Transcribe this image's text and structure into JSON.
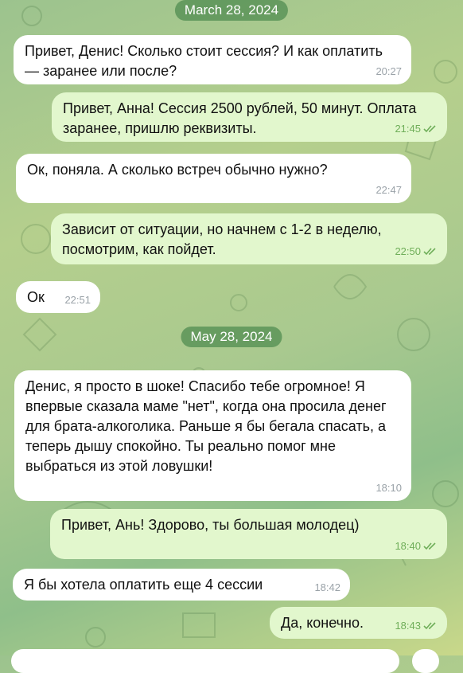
{
  "colors": {
    "incoming_bg": "#ffffff",
    "outgoing_bg": "#e2f7cd",
    "date_pill_bg": "#5a9a5a",
    "outgoing_time": "#6fae59"
  },
  "dates": {
    "first": "March 28, 2024",
    "second": "May 28, 2024"
  },
  "messages": [
    {
      "direction": "in",
      "text": "Привет, Денис! Сколько стоит сессия? И как оплатить — заранее или после?",
      "time": "20:27",
      "read": false
    },
    {
      "direction": "out",
      "text": "Привет, Анна! Сессия 2500 рублей, 50 минут. Оплата заранее, пришлю реквизиты.",
      "time": "21:45",
      "read": true
    },
    {
      "direction": "in",
      "text": "Ок, поняла. А сколько встреч обычно нужно?",
      "time": "22:47",
      "read": false
    },
    {
      "direction": "out",
      "text": "Зависит от ситуации, но начнем с 1-2 в неделю, посмотрим, как пойдет.",
      "time": "22:50",
      "read": true
    },
    {
      "direction": "in",
      "text": "Ок",
      "time": "22:51",
      "read": false
    },
    {
      "direction": "in",
      "text": "Денис, я просто в шоке! Спасибо тебе огромное! Я впервые сказала маме \"нет\", когда она просила денег для брата-алкоголика. Раньше я бы бегала спасать, а теперь дышу спокойно. Ты реально помог мне выбраться из этой ловушки!",
      "time": "18:10",
      "read": false
    },
    {
      "direction": "out",
      "text": "Привет, Ань! Здорово, ты большая молодец)",
      "time": "18:40",
      "read": true
    },
    {
      "direction": "in",
      "text": "Я бы хотела оплатить еще 4 сессии",
      "time": "18:42",
      "read": false
    },
    {
      "direction": "out",
      "text": "Да, конечно.",
      "time": "18:43",
      "read": true
    }
  ]
}
